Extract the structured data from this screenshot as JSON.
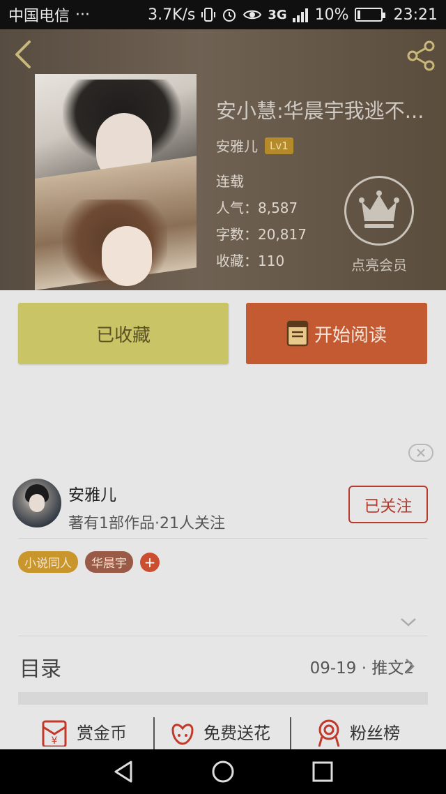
{
  "status_bar": {
    "carrier": "中国电信",
    "dots": "···",
    "speed": "3.7K/s",
    "network": "3G",
    "battery": "10%",
    "time": "23:21",
    "icons": [
      "vibrate-icon",
      "alarm-icon",
      "eye-icon",
      "signal-icon",
      "battery-icon"
    ]
  },
  "book": {
    "title": "安小慧:华晨宇我逃不...",
    "author": "安雅儿",
    "level": "Lv1",
    "status": "连载",
    "popularity_label": "人气：",
    "popularity": "8,587",
    "words_label": "字数：",
    "words": "20,817",
    "collections_label": "收藏：",
    "collections": "110",
    "vip_label": "点亮会员"
  },
  "actions": {
    "collected": "已收藏",
    "start_reading": "开始阅读"
  },
  "author_card": {
    "name": "安雅儿",
    "info": "著有1部作品·21人关注",
    "follow": "已关注"
  },
  "tags": [
    "小说同人",
    "华晨宇",
    "+"
  ],
  "catalog": {
    "label": "目录",
    "update": "09-19 · 推文2"
  },
  "bottom_actions": [
    "赏金币",
    "免费送花",
    "粉丝榜"
  ],
  "colors": {
    "collected_btn": "#c9c466",
    "read_btn": "#c45a32",
    "follow": "#b73a2e",
    "tag_1": "#c9962b",
    "tag_2": "#9a5a48"
  }
}
